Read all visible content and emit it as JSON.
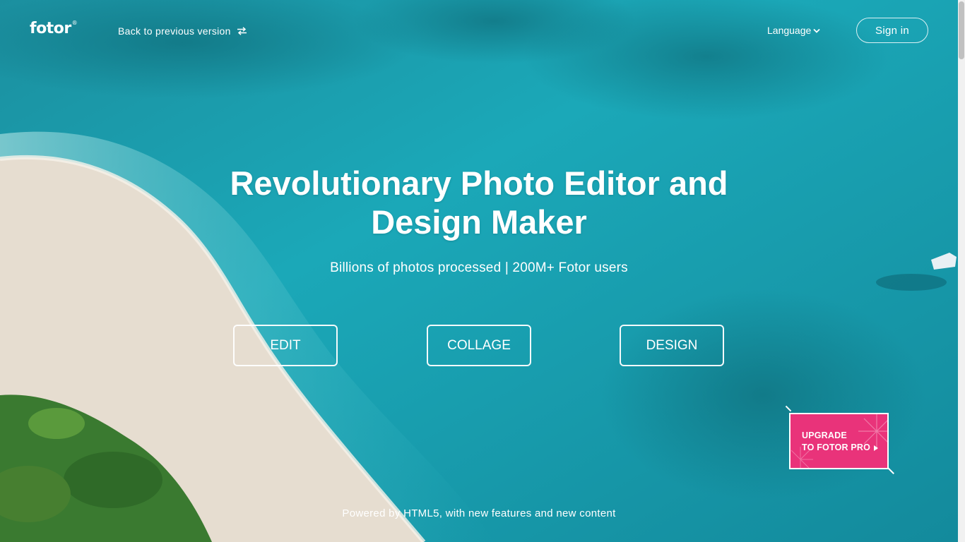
{
  "header": {
    "logo_text": "fotor",
    "logo_mark": "®",
    "back_link": "Back to previous version",
    "back_icon": "swap-arrows-icon",
    "language_label": "Language",
    "language_icon": "chevron-down-icon",
    "signin_label": "Sign in"
  },
  "hero": {
    "title_line1": "Revolutionary Photo Editor and",
    "title_line2": "Design Maker",
    "subtitle": "Billions of photos processed | 200M+ Fotor users"
  },
  "actions": {
    "edit": "EDIT",
    "collage": "COLLAGE",
    "design": "DESIGN"
  },
  "promo": {
    "line1": "UPGRADE",
    "line2": "TO FOTOR PRO",
    "icon": "play-triangle-icon",
    "color": "#e9337a"
  },
  "footer": {
    "note": "Powered by HTML5, with new features and new content"
  },
  "colors": {
    "ocean": "#1aa3b3",
    "sand": "#e8e2d6",
    "foliage": "#3f7a32"
  }
}
